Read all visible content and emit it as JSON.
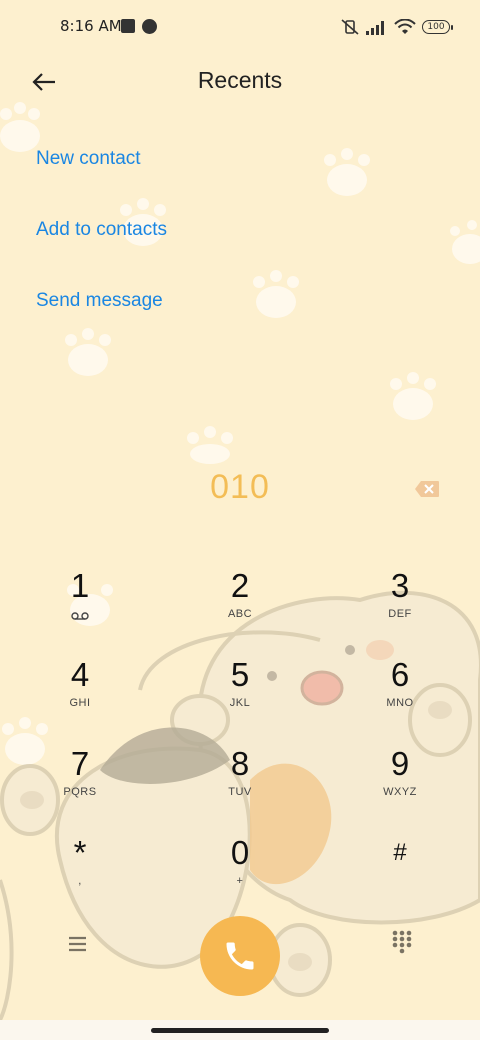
{
  "status": {
    "time": "8:16 AM",
    "battery": "100"
  },
  "header": {
    "title": "Recents"
  },
  "actions": {
    "new_contact": "New contact",
    "add_to_contacts": "Add to contacts",
    "send_message": "Send message"
  },
  "dialer": {
    "number": "010"
  },
  "keypad": {
    "k1": {
      "digit": "1",
      "letters": ""
    },
    "k2": {
      "digit": "2",
      "letters": "ABC"
    },
    "k3": {
      "digit": "3",
      "letters": "DEF"
    },
    "k4": {
      "digit": "4",
      "letters": "GHI"
    },
    "k5": {
      "digit": "5",
      "letters": "JKL"
    },
    "k6": {
      "digit": "6",
      "letters": "MNO"
    },
    "k7": {
      "digit": "7",
      "letters": "PQRS"
    },
    "k8": {
      "digit": "8",
      "letters": "TUV"
    },
    "k9": {
      "digit": "9",
      "letters": "WXYZ"
    },
    "kstar": {
      "digit": "*",
      "letters": ","
    },
    "k0": {
      "digit": "0",
      "letters": "+"
    },
    "khash": {
      "digit": "#",
      "letters": ""
    }
  },
  "icons": {
    "back": "back-arrow-icon",
    "backspace": "backspace-icon",
    "voicemail": "voicemail-icon",
    "menu": "menu-icon",
    "call": "phone-icon",
    "dialpad": "dialpad-icon"
  },
  "colors": {
    "accent_link": "#1a86e2",
    "number": "#f3bd56",
    "call_button": "#f6b852",
    "background": "#fdf0cf"
  }
}
